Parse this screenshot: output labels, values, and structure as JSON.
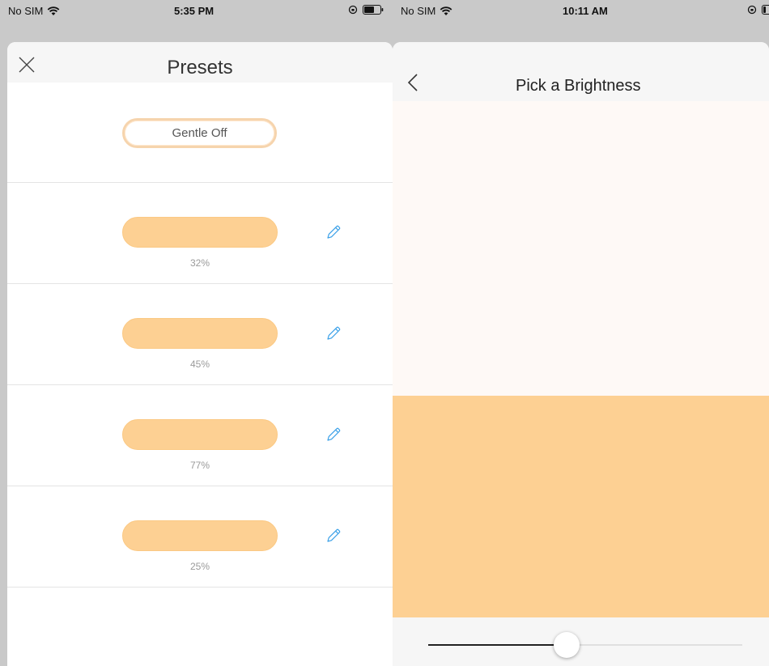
{
  "colors": {
    "preset_swatch": "#fdd093",
    "edit_icon": "#3aa0e8",
    "gentle_off_border": "#f6d4ad",
    "preview_top": "#fef9f6",
    "preview_bottom": "#fdd093",
    "backdrop": "#c9c9c9"
  },
  "left_screen": {
    "status_bar": {
      "carrier": "No SIM",
      "time": "5:35 PM",
      "icons": [
        "wifi-icon",
        "orientation-lock-icon",
        "battery-icon"
      ]
    },
    "header": {
      "title": "Presets",
      "close_icon": "close-icon"
    },
    "gentle_off_label": "Gentle Off",
    "presets": [
      {
        "percent_label": "32%",
        "brightness": 32,
        "edit_icon": "pencil-icon"
      },
      {
        "percent_label": "45%",
        "brightness": 45,
        "edit_icon": "pencil-icon"
      },
      {
        "percent_label": "77%",
        "brightness": 77,
        "edit_icon": "pencil-icon"
      },
      {
        "percent_label": "25%",
        "brightness": 25,
        "edit_icon": "pencil-icon"
      }
    ]
  },
  "right_screen": {
    "status_bar": {
      "carrier": "No SIM",
      "time": "10:11 AM",
      "icons": [
        "wifi-icon",
        "orientation-lock-icon",
        "battery-icon"
      ]
    },
    "header": {
      "title": "Pick a Brightness",
      "back_icon": "chevron-left-icon"
    },
    "slider": {
      "value_fraction": 0.44
    }
  }
}
